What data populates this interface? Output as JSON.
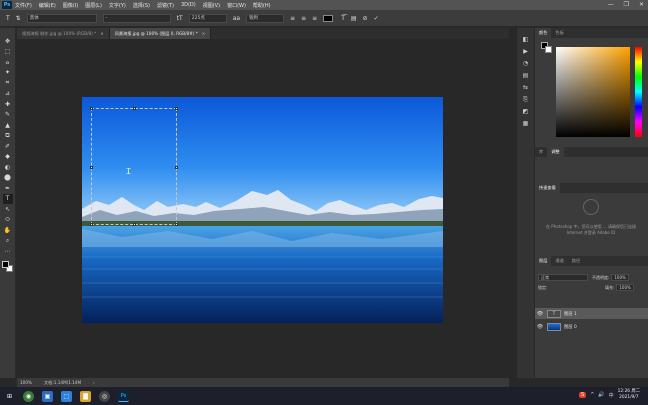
{
  "menubar": {
    "logo": "Ps",
    "items": [
      "文件(F)",
      "编辑(E)",
      "图像(I)",
      "图层(L)",
      "文字(Y)",
      "选择(S)",
      "滤镜(T)",
      "3D(D)",
      "视图(V)",
      "窗口(W)",
      "帮助(H)"
    ],
    "minimize": "—",
    "maximize": "❐",
    "close": "✕"
  },
  "options": {
    "tool_icon": "T",
    "orient_icon": "⇅",
    "font_family": "黑体",
    "font_style": "-",
    "size_icon": "tT",
    "font_size": "225点",
    "aa_icon": "aa",
    "antialias": "锐利",
    "align_left": "≡",
    "align_center": "≡",
    "align_right": "≡",
    "text_color": "#000000",
    "warp_icon": "T͡",
    "panel_icon": "▤",
    "cancel_icon": "⊘",
    "commit_icon": "✓"
  },
  "toolbar": {
    "tools": [
      "✥",
      "⬚",
      "ⴰ",
      "✦",
      "⌗",
      "⊿",
      "✚",
      "✎",
      "▲",
      "⧉",
      "✐",
      "◆",
      "◐",
      "⬤",
      "✒",
      "T",
      "↖",
      "⬭",
      "✋",
      "⌕",
      "⋯"
    ]
  },
  "tabs": [
    {
      "label": "视频海报 制作.jpg @ 100% (RGB/8) *",
      "close": "×",
      "active": false
    },
    {
      "label": "风景海报.jpg @ 100% (图层 0, RGB/8#) *",
      "close": "×",
      "active": true
    }
  ],
  "canvas": {
    "ibeam": "Ꮖ"
  },
  "status": {
    "zoom": "100%",
    "doc": "文档:1.14M/1.14M",
    "arrow": "›"
  },
  "sidestrip": {
    "icons": [
      "◧",
      "▶",
      "◔",
      "▤",
      "⇆",
      "⎘",
      "◩",
      "▦"
    ]
  },
  "panels": {
    "color_tabs": [
      "颜色",
      "色板"
    ],
    "adjust_tabs": [
      "库",
      "调整"
    ],
    "learn_title": "快速查看",
    "learn_text": "在 Photoshop 中，您可以使用 ... 请确保您已连接 Internet 并登录 Adobe ID",
    "layers_tabs": [
      "图层",
      "通道",
      "路径"
    ],
    "blend_mode": "正常",
    "opacity_label": "不透明度:",
    "opacity_value": "100%",
    "lock_label": "锁定:",
    "fill_label": "填充:",
    "fill_value": "100%",
    "layers": [
      {
        "name": "图层 1",
        "eye": "👁",
        "selected": true
      },
      {
        "name": "图层 0",
        "eye": "👁",
        "selected": false
      }
    ]
  },
  "taskbar": {
    "icons": [
      "⊞",
      "◉",
      "▣",
      "⬚",
      "▇",
      "◎",
      "Ps"
    ],
    "tray": [
      "S",
      "^",
      "🔊",
      "中"
    ],
    "time": "12:26 周二",
    "date": "2021/9/7"
  }
}
